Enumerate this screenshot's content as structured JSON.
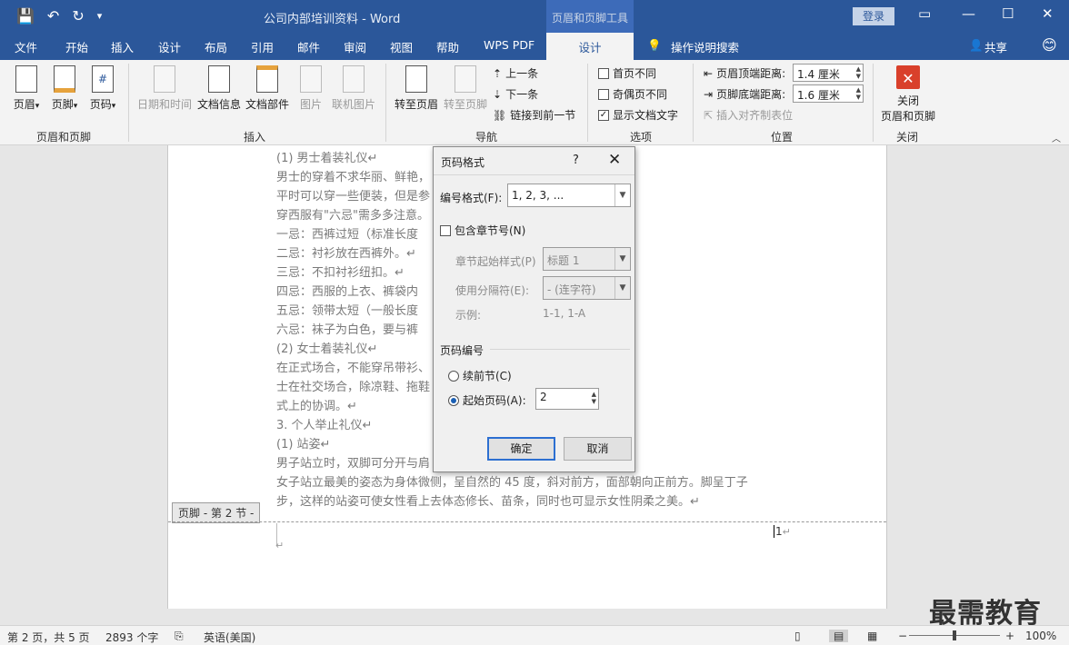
{
  "titlebar": {
    "title": "公司内部培训资料  -  Word",
    "context_tools": "页眉和页脚工具",
    "login": "登录"
  },
  "tabs": {
    "file": "文件",
    "home": "开始",
    "insert": "插入",
    "design": "设计",
    "layout": "布局",
    "references": "引用",
    "mailings": "邮件",
    "review": "审阅",
    "view": "视图",
    "help": "帮助",
    "wps": "WPS PDF",
    "hf_design": "设计",
    "tell_me": "操作说明搜索",
    "share": "共享"
  },
  "ribbon": {
    "header": "页眉",
    "footer": "页脚",
    "page_number": "页码",
    "group_hf": "页眉和页脚",
    "date_time": "日期和时间",
    "doc_info": "文档信息",
    "doc_parts": "文档部件",
    "picture": "图片",
    "online_picture": "联机图片",
    "group_insert": "插入",
    "goto_header": "转至页眉",
    "goto_footer": "转至页脚",
    "prev": "上一条",
    "next": "下一条",
    "link_prev": "链接到前一节",
    "group_nav": "导航",
    "first_page_diff": "首页不同",
    "odd_even_diff": "奇偶页不同",
    "show_doc_text": "显示文档文字",
    "group_options": "选项",
    "header_top": "页眉顶端距离:",
    "header_top_val": "1.4 厘米",
    "footer_bottom": "页脚底端距离:",
    "footer_bottom_val": "1.6 厘米",
    "insert_align_tab": "插入对齐制表位",
    "group_position": "位置",
    "close_hf_1": "关闭",
    "close_hf_2": "页眉和页脚",
    "group_close": "关闭"
  },
  "document": {
    "lines": [
      "(1) 男士着装礼仪↵",
      "男士的穿着不求华丽、鲜艳，                                    以不超过三种颜色为原则。",
      "平时可以穿一些便装，但是参                                    或西服。↵",
      "穿西服有\"六忌\"需多多注意。",
      "一忌：西裤过短（标准长度",
      "二忌：衬衫放在西裤外。↵",
      "三忌：不扣衬衫纽扣。↵",
      "四忌：西服的上衣、裤袋内",
      "五忌：领带太短（一般长度",
      "六忌：袜子为白色，要与裤",
      "(2) 女士着装礼仪↵",
      "在正式场合，不能穿吊带衫、                                    应穿典雅大方的服装。女",
      "士在社交场合，除凉鞋、拖鞋                                    意鞋子和衣裙在色彩、款",
      "式上的协调。↵",
      "3. 个人举止礼仪↵",
      "(1) 站姿↵",
      "男子站立时，双脚可分开与肩                                    ↵",
      "女子站立最美的姿态为身体微侧，呈自然的 45 度，斜对前方，面部朝向正前方。脚呈丁子",
      "步，这样的站姿可使女性看上去体态修长、苗条，同时也可显示女性阴柔之美。↵"
    ],
    "footer_label": "页脚 - 第 2 节 -",
    "footer_page_num": "1",
    "return_mark": "↵"
  },
  "dialog": {
    "title": "页码格式",
    "help": "?",
    "close": "✕",
    "number_format_label": "编号格式(F):",
    "number_format_value": "1, 2, 3, ...",
    "include_chapter": "包含章节号(N)",
    "chapter_style_label": "章节起始样式(P)",
    "chapter_style_value": "标题 1",
    "separator_label": "使用分隔符(E):",
    "separator_value": "-   (连字符)",
    "example_label": "示例:",
    "example_value": "1-1, 1-A",
    "numbering_section": "页码编号",
    "continue_label": "续前节(C)",
    "start_at_label": "起始页码(A):",
    "start_at_value": "2",
    "ok": "确定",
    "cancel": "取消"
  },
  "statusbar": {
    "page": "第 2 页，共 5 页",
    "words": "2893 个字",
    "language": "英语(美国)",
    "zoom": "100%",
    "zoom_minus": "−",
    "zoom_plus": "+"
  },
  "watermark": "最需教育"
}
